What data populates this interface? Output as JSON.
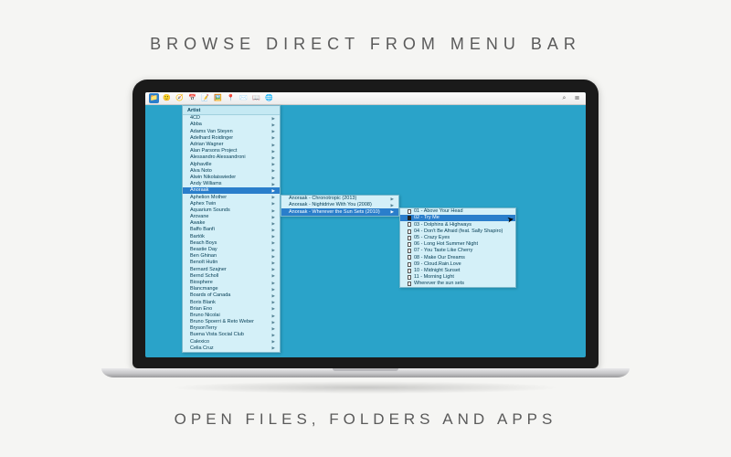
{
  "headline": "BROWSE DIRECT FROM MENU BAR",
  "tagline": "OPEN FILES, FOLDERS AND APPS",
  "menubar": {
    "icons": [
      "folder",
      "finder",
      "safari",
      "calendar",
      "notes",
      "photos",
      "maps",
      "mail",
      "reader",
      "globe"
    ],
    "right": [
      "search",
      "list"
    ]
  },
  "column1": {
    "header": "Artist",
    "items": [
      "4CD",
      "Abba",
      "Adams Van Steyen",
      "Adelhard Roidinger",
      "Adrian Wagner",
      "Alan Parsons Project",
      "Alessandro Alessandroni",
      "Alphaville",
      "Alva Noto",
      "Alwin Nikolaiswieder",
      "Andy Williams",
      "Anoraak",
      "Aphelion Mother",
      "Aphex Twin",
      "Aquarium Sounds",
      "Arovane",
      "Awake",
      "Baffo Banfi",
      "Bartók",
      "Beach Boys",
      "Beastie Day",
      "Ben Ghinan",
      "Benoît Hutin",
      "Bernard Szajner",
      "Bernd Scholl",
      "Biosphere",
      "Blancmange",
      "Boards of Canada",
      "Boris Blank",
      "Brian Eno",
      "Bruno Nicolai",
      "Bruno Spoerri & Reto Weber",
      "BrysonTerry",
      "Buena Vista Social Club",
      "Calexico",
      "Celia Cruz"
    ],
    "selected_index": 11
  },
  "column2": {
    "items": [
      "Anoraak - Chronotropic (2013)",
      "Anoraak - Nightdrive With You (2008)",
      "Anoraak - Wherever the Sun Sets (2010)"
    ],
    "selected_index": 2
  },
  "column3": {
    "items": [
      "01 - Above Your Head",
      "02 - Try Me",
      "03 - Dolphins & Highways",
      "04 - Don't Be Afraid (feat. Sally Shapiro)",
      "05 - Crazy Eyes",
      "06 - Long Hot Summer Night",
      "07 - You Taste Like Cherry",
      "08 - Make Our Dreams",
      "09 - Cloud.Rain.Love",
      "10 - Midnight Sunset",
      "11 - Morning Light",
      "Wherever the sun sets"
    ],
    "selected_index": 1
  }
}
